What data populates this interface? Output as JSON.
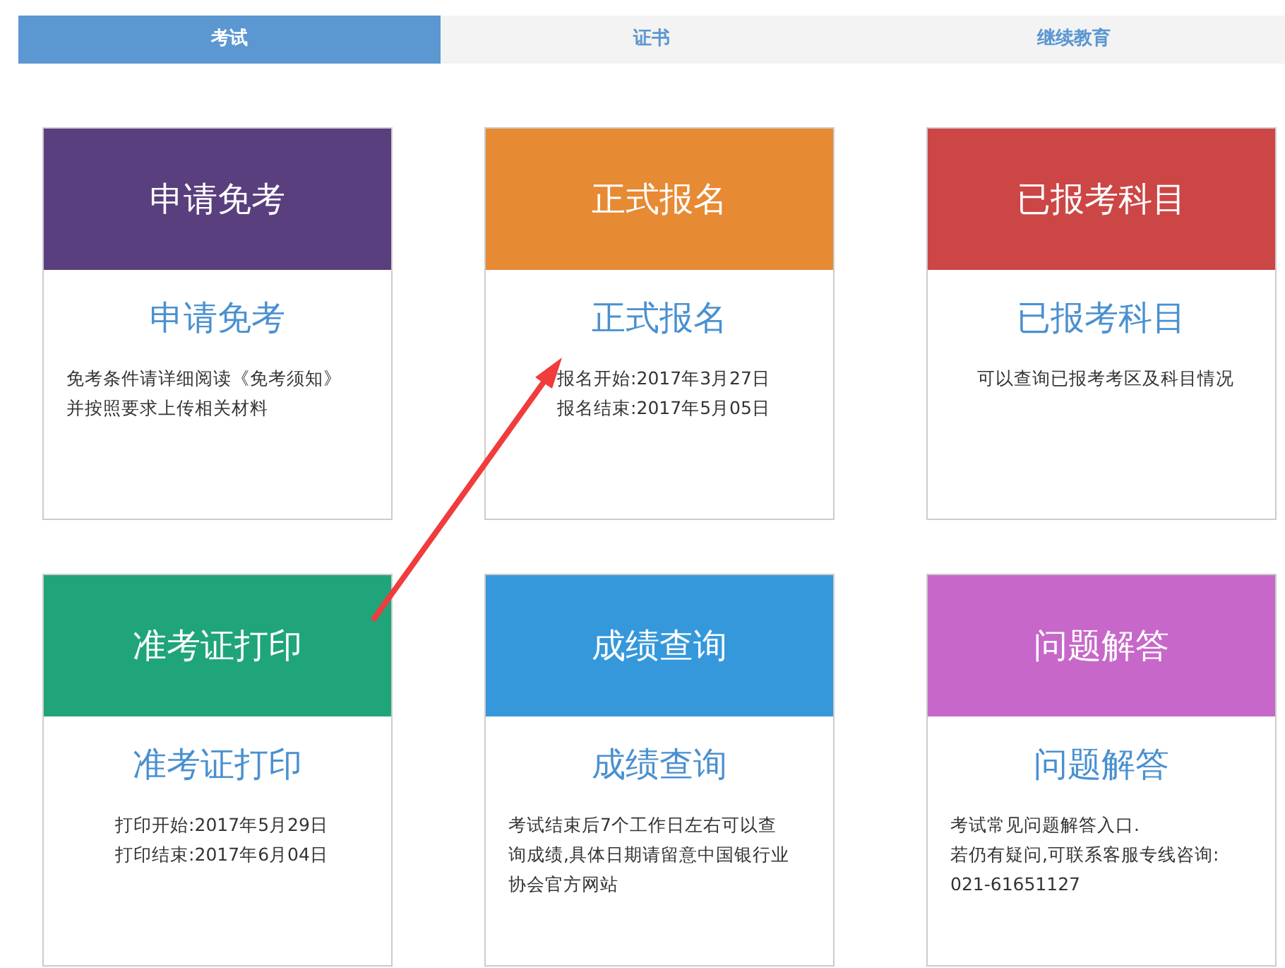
{
  "tabs": [
    {
      "label": "考试",
      "selected": true
    },
    {
      "label": "证书",
      "selected": false
    },
    {
      "label": "继续教育",
      "selected": false
    }
  ],
  "cards": [
    {
      "banner": "申请免考",
      "title": "申请免考",
      "color": "#5a3f7e",
      "lines": [
        "免考条件请详细阅读《免考须知》",
        "并按照要求上传相关材料"
      ]
    },
    {
      "banner": "正式报名",
      "title": "正式报名",
      "color": "#e68a33",
      "lines": [
        "报名开始:2017年3月27日",
        "报名结束:2017年5月05日"
      ]
    },
    {
      "banner": "已报考科目",
      "title": "已报考科目",
      "color": "#cc4646",
      "lines": [
        "可以查询已报考考区及科目情况"
      ]
    },
    {
      "banner": "准考证打印",
      "title": "准考证打印",
      "color": "#20a57a",
      "lines": [
        "打印开始:2017年5月29日",
        "打印结束:2017年6月04日"
      ]
    },
    {
      "banner": "成绩查询",
      "title": "成绩查询",
      "color": "#3598db",
      "lines": [
        "考试结束后7个工作日左右可以查",
        "询成绩,具体日期请留意中国银行业",
        "协会官方网站"
      ]
    },
    {
      "banner": "问题解答",
      "title": "问题解答",
      "color": "#c767c9",
      "lines": [
        "考试常见问题解答入口.",
        "若仍有疑问,可联系客服专线咨询:",
        "021-61651127"
      ]
    }
  ]
}
